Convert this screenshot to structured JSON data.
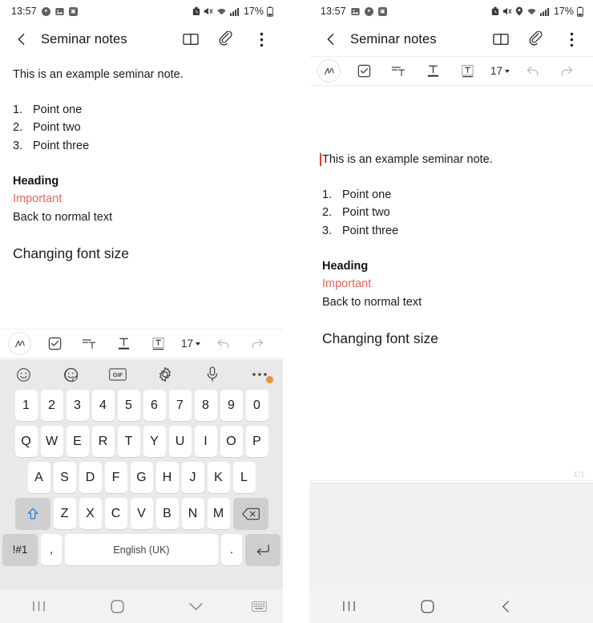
{
  "meta": {
    "app": "Samsung Notes",
    "accent_red": "#e8655b",
    "caret_red": "#e53935"
  },
  "left": {
    "status": {
      "time": "13:57",
      "icons_left": [
        "photos-icon",
        "gallery-icon",
        "app-icon"
      ],
      "icons_right": [
        "alarm-icon",
        "mute-icon",
        "wifi-icon",
        "signal-icon"
      ],
      "battery": "17%"
    },
    "appbar": {
      "back_icon": "back-chevron-icon",
      "title": "Seminar notes",
      "actions": [
        "book-view-icon",
        "attachment-icon",
        "overflow-menu-icon"
      ]
    },
    "note": {
      "intro": "This is an example seminar note.",
      "list": [
        {
          "num": "1.",
          "text": "Point one"
        },
        {
          "num": "2.",
          "text": "Point two"
        },
        {
          "num": "3.",
          "text": "Point three"
        }
      ],
      "heading": "Heading",
      "important": "Important",
      "normal": "Back to normal text",
      "big": "Changing font size"
    },
    "toolbar": {
      "pen_icon": "handwriting-pen-icon",
      "checkbox_icon": "checklist-icon",
      "indent_icon": "paragraph-align-icon",
      "textcolor_icon": "text-format-icon",
      "textbox_icon": "text-box-icon",
      "font_size": "17",
      "undo_icon": "undo-icon",
      "redo_icon": "redo-icon"
    },
    "keyboard": {
      "top_icons": [
        "emoji-icon",
        "sticker-icon",
        "gif-icon",
        "settings-icon",
        "microphone-icon",
        "more-options-icon"
      ],
      "row1": [
        "1",
        "2",
        "3",
        "4",
        "5",
        "6",
        "7",
        "8",
        "9",
        "0"
      ],
      "row2": [
        "Q",
        "W",
        "E",
        "R",
        "T",
        "Y",
        "U",
        "I",
        "O",
        "P"
      ],
      "row3": [
        "A",
        "S",
        "D",
        "F",
        "G",
        "H",
        "J",
        "K",
        "L"
      ],
      "row4": [
        "Z",
        "X",
        "C",
        "V",
        "B",
        "N",
        "M"
      ],
      "shift_icon": "shift-up-icon",
      "backspace_icon": "backspace-icon",
      "symbols_key": "!#1",
      "comma_key": ",",
      "space_key": "English (UK)",
      "period_key": ".",
      "return_icon": "return-enter-icon"
    },
    "nav": [
      "recents-icon",
      "home-icon",
      "hide-keyboard-icon",
      "keyboard-switch-icon"
    ]
  },
  "right": {
    "status": {
      "time": "13:57",
      "icons_left": [
        "gallery-icon",
        "photos-icon",
        "app-icon"
      ],
      "icons_right": [
        "alarm-icon",
        "mute-icon",
        "location-icon",
        "wifi-icon",
        "signal-icon"
      ],
      "battery": "17%"
    },
    "appbar": {
      "back_icon": "back-chevron-icon",
      "title": "Seminar notes",
      "actions": [
        "book-view-icon",
        "attachment-icon",
        "overflow-menu-icon"
      ]
    },
    "toolbar": {
      "pen_icon": "handwriting-pen-icon",
      "checkbox_icon": "checklist-icon",
      "indent_icon": "paragraph-align-icon",
      "textcolor_icon": "text-format-icon",
      "textbox_icon": "text-box-icon",
      "font_size": "17",
      "undo_icon": "undo-icon",
      "redo_icon": "redo-icon"
    },
    "note": {
      "intro": "This is an example seminar note.",
      "list": [
        {
          "num": "1.",
          "text": "Point one"
        },
        {
          "num": "2.",
          "text": "Point two"
        },
        {
          "num": "3.",
          "text": "Point three"
        }
      ],
      "heading": "Heading",
      "important": "Important",
      "normal": "Back to normal text",
      "big": "Changing font size"
    },
    "page_indicator": "1/1",
    "nav": [
      "recents-icon",
      "home-icon",
      "back-icon"
    ]
  }
}
